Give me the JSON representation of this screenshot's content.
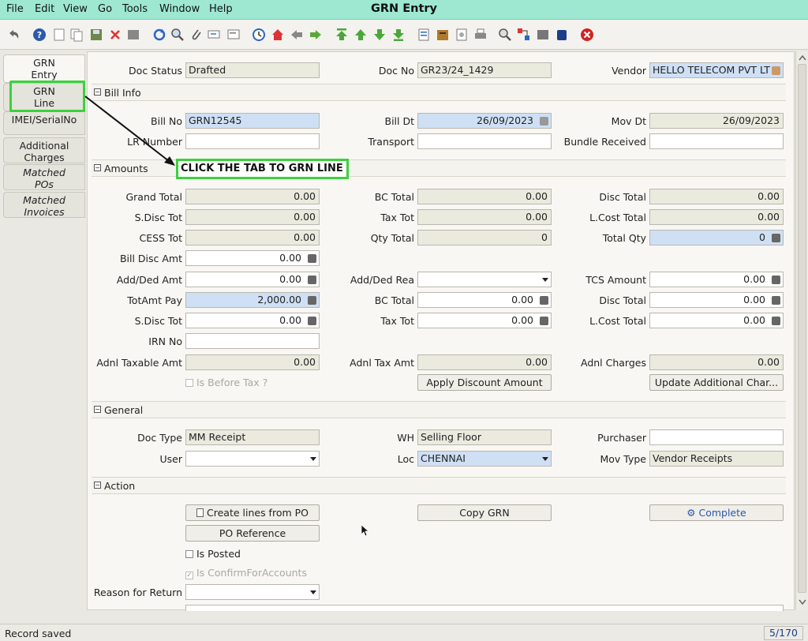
{
  "window": {
    "title": "GRN Entry"
  },
  "menu": [
    "File",
    "Edit",
    "View",
    "Go",
    "Tools",
    "Window",
    "Help"
  ],
  "tabs": [
    "GRN\nEntry",
    "GRN\nLine",
    "IMEI/SerialNo",
    "Additional\nCharges",
    "Matched\nPOs",
    "Matched\nInvoices"
  ],
  "callout": "CLICK THE TAB TO GRN LINE",
  "header": {
    "doc_status_label": "Doc Status",
    "doc_status": "Drafted",
    "doc_no_label": "Doc No",
    "doc_no": "GR23/24_1429",
    "vendor_label": "Vendor",
    "vendor": "HELLO TELECOM PVT LT"
  },
  "sections": {
    "bill_info": "Bill Info",
    "amounts": "Amounts",
    "general": "General",
    "action": "Action"
  },
  "bill_info": {
    "bill_no_label": "Bill No",
    "bill_no": "GRN12545",
    "bill_dt_label": "Bill Dt",
    "bill_dt": "26/09/2023",
    "mov_dt_label": "Mov Dt",
    "mov_dt": "26/09/2023",
    "lr_label": "LR Number",
    "lr": "",
    "transport_label": "Transport",
    "transport": "",
    "bundle_label": "Bundle Received",
    "bundle": ""
  },
  "amounts": {
    "grand_total_label": "Grand Total",
    "grand_total": "0.00",
    "bc_total_label": "BC Total",
    "bc_total": "0.00",
    "disc_total_label": "Disc Total",
    "disc_total": "0.00",
    "sdisc_tot_label": "S.Disc Tot",
    "sdisc_tot": "0.00",
    "tax_tot_label": "Tax Tot",
    "tax_tot": "0.00",
    "lcost_total_label": "L.Cost Total",
    "lcost_total": "0.00",
    "cess_tot_label": "CESS Tot",
    "cess_tot": "0.00",
    "qty_total_label": "Qty Total",
    "qty_total": "0",
    "total_qty_label": "Total Qty",
    "total_qty": "0",
    "bill_disc_amt_label": "Bill Disc Amt",
    "bill_disc_amt": "0.00",
    "add_ded_amt_label": "Add/Ded Amt",
    "add_ded_amt": "0.00",
    "add_ded_rea_label": "Add/Ded Rea",
    "add_ded_rea": "",
    "tcs_amount_label": "TCS Amount",
    "tcs_amount": "0.00",
    "totamt_pay_label": "TotAmt Pay",
    "totamt_pay": "2,000.00",
    "bc_total2_label": "BC Total",
    "bc_total2": "0.00",
    "disc_total2_label": "Disc Total",
    "disc_total2": "0.00",
    "sdisc_tot2_label": "S.Disc Tot",
    "sdisc_tot2": "0.00",
    "tax_tot2_label": "Tax Tot",
    "tax_tot2": "0.00",
    "lcost_total2_label": "L.Cost Total",
    "lcost_total2": "0.00",
    "irn_no_label": "IRN No",
    "irn_no": "",
    "adnl_taxable_label": "Adnl Taxable Amt",
    "adnl_taxable": "0.00",
    "adnl_tax_label": "Adnl Tax Amt",
    "adnl_tax": "0.00",
    "adnl_charges_label": "Adnl Charges",
    "adnl_charges": "0.00",
    "is_before_tax": "Is Before Tax ?",
    "apply_discount_btn": "Apply Discount Amount",
    "update_charges_btn": "Update Additional Char..."
  },
  "general": {
    "doc_type_label": "Doc Type",
    "doc_type": "MM Receipt",
    "wh_label": "WH",
    "wh": "Selling Floor",
    "purchaser_label": "Purchaser",
    "purchaser": "",
    "user_label": "User",
    "user": "",
    "loc_label": "Loc",
    "loc": "CHENNAI",
    "mov_type_label": "Mov Type",
    "mov_type": "Vendor Receipts"
  },
  "action": {
    "create_lines_btn": "Create lines from PO",
    "copy_grn_btn": "Copy GRN",
    "complete_btn": "Complete",
    "po_reference_btn": "PO Reference",
    "is_posted": "Is Posted",
    "is_confirm": "Is ConfirmForAccounts",
    "reason_label": "Reason for Return",
    "reason": ""
  },
  "status": {
    "message": "Record saved",
    "record": "5/170"
  },
  "colors": {
    "accent_green": "#3ad23a",
    "title_bar": "#9ee8d2"
  }
}
